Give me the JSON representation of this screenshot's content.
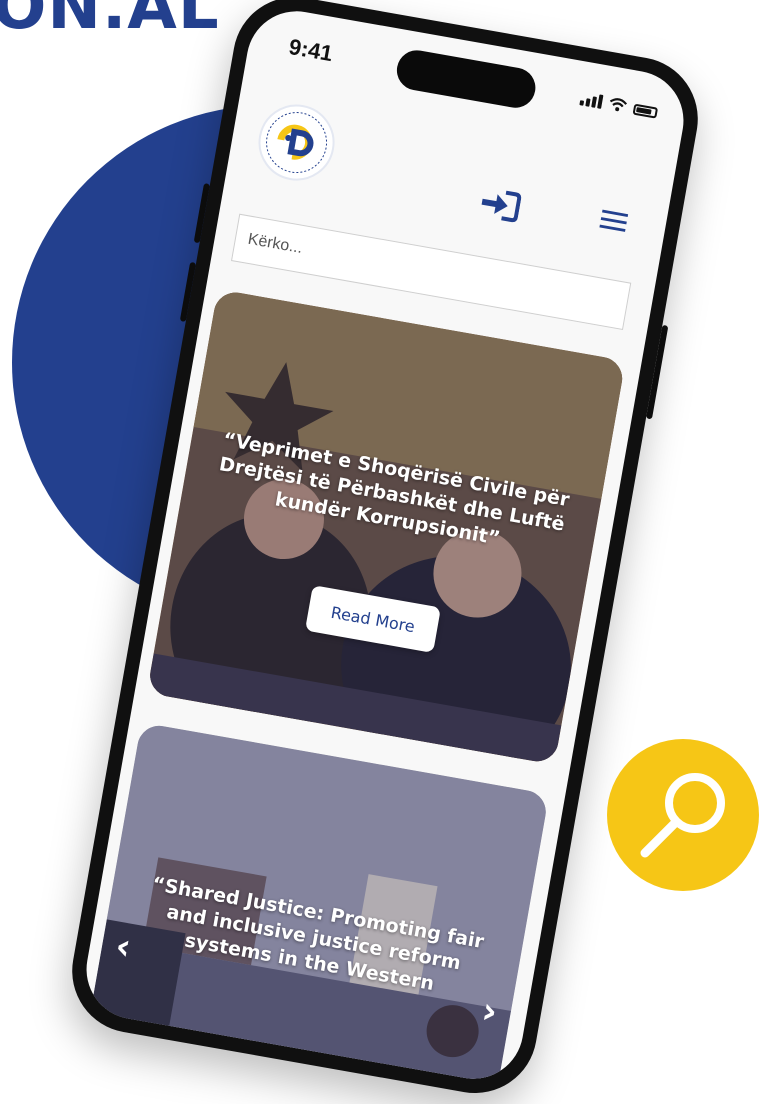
{
  "brand": {
    "text": "ON.AL",
    "color": "#23408e"
  },
  "status_bar": {
    "time": "9:41"
  },
  "header": {
    "logo_icon": "cso-logo",
    "login_icon": "login-arrow-icon",
    "menu_icon": "hamburger-menu-icon"
  },
  "search": {
    "placeholder": "Kërko..."
  },
  "cards": [
    {
      "title": "“Veprimet e Shoqërisë Civile për Drejtësi të Përbashkët dhe Luftë kundër Korrupsionit”",
      "button": "Read More"
    },
    {
      "title": "“Shared Justice: Promoting fair and inclusive justice reform systems in the Western",
      "prev": "‹",
      "next": "›"
    }
  ],
  "colors": {
    "accent_blue": "#23408e",
    "accent_yellow": "#f6c616"
  },
  "badge_icon": "magnifier-icon"
}
